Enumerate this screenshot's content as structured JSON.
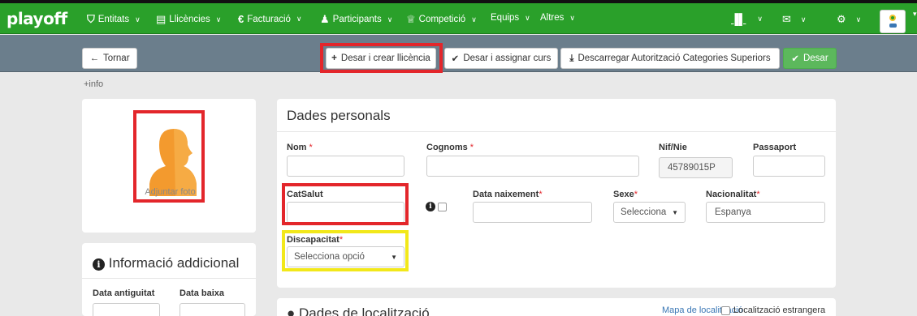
{
  "app": {
    "brand": "playoff"
  },
  "nav": {
    "items": [
      {
        "label": "Entitats",
        "icon": "shield-icon"
      },
      {
        "label": "Llicències",
        "icon": "id-card-icon"
      },
      {
        "label": "Facturació",
        "icon": "euro-icon"
      },
      {
        "label": "Participants",
        "icon": "user-icon"
      },
      {
        "label": "Competició",
        "icon": "trophy-icon"
      },
      {
        "label": "Equips",
        "icon": ""
      },
      {
        "label": "Altres",
        "icon": ""
      }
    ],
    "right_icons": [
      "bar-chart-icon",
      "envelope-icon",
      "gear-icon"
    ]
  },
  "toolbar": {
    "back_label": "Tornar",
    "save_create_label": "Desar i crear llicència",
    "save_assign_label": "Desar i assignar curs",
    "download_label": "Descarregar Autorització Categories Superiors",
    "save_label": "Desar"
  },
  "info_link": "+info",
  "photo": {
    "label": "Adjuntar foto"
  },
  "additional": {
    "title": "Informació addicional",
    "antiguitat_label": "Data antiguitat",
    "baixa_label": "Data baixa"
  },
  "personal": {
    "title": "Dades personals",
    "nom_label": "Nom",
    "cognoms_label": "Cognoms",
    "nif_label": "Nif/Nie",
    "nif_value": "45789015P",
    "passaport_label": "Passaport",
    "catsalut_label": "CatSalut",
    "naixement_label": "Data naixement",
    "sexe_label": "Sexe",
    "sexe_value": "Selecciona",
    "nacionalitat_label": "Nacionalitat",
    "nacionalitat_value": "Espanya",
    "discapacitat_label": "Discapacitat",
    "discapacitat_value": "Selecciona opció",
    "required_mark": "*"
  },
  "location": {
    "title": "Dades de localització",
    "map_link": "Mapa de localització",
    "foreign_label": "Localització estrangera"
  },
  "colors": {
    "nav_green": "#2aa02a",
    "subbar": "#6b7e8c",
    "highlight_red": "#e3262b",
    "highlight_yellow": "#f2e81a"
  }
}
